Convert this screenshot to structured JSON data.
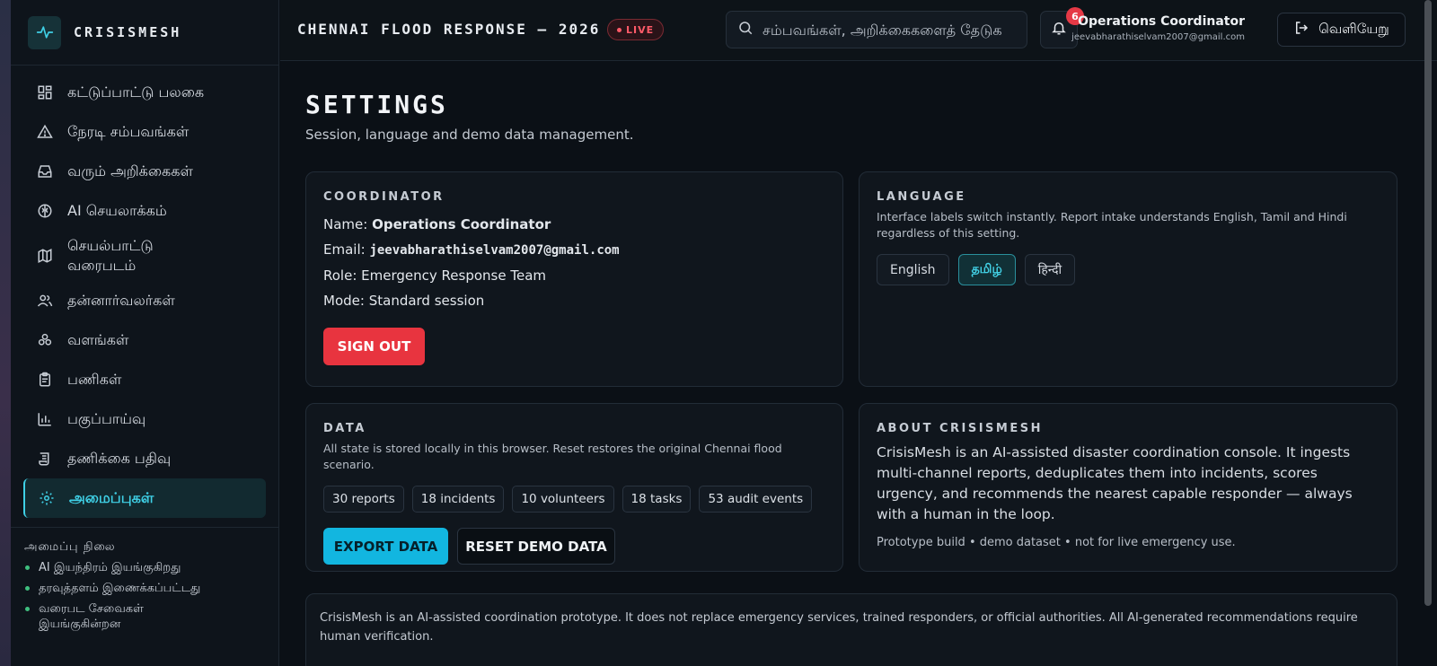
{
  "brand": {
    "name": "CRISISMESH"
  },
  "sidebar": {
    "items": [
      {
        "label": "கட்டுப்பாட்டு பலகை",
        "icon": "dashboard-icon"
      },
      {
        "label": "நேரடி சம்பவங்கள்",
        "icon": "warning-icon"
      },
      {
        "label": "வரும் அறிக்கைகள்",
        "icon": "inbox-icon"
      },
      {
        "label": "AI செயலாக்கம்",
        "icon": "brain-icon"
      },
      {
        "label": "செயல்பாட்டு வரைபடம்",
        "icon": "map-icon"
      },
      {
        "label": "தன்னார்வலர்கள்",
        "icon": "users-icon"
      },
      {
        "label": "வளங்கள்",
        "icon": "boxes-icon"
      },
      {
        "label": "பணிகள்",
        "icon": "clipboard-icon"
      },
      {
        "label": "பகுப்பாய்வு",
        "icon": "bar-chart-icon"
      },
      {
        "label": "தணிக்கை பதிவு",
        "icon": "scroll-icon"
      },
      {
        "label": "அமைப்புகள்",
        "icon": "gear-icon"
      }
    ],
    "system_title": "அமைப்பு நிலை",
    "system_items": [
      "AI இயந்திரம் இயங்குகிறது",
      "தரவுத்தளம் இணைக்கப்பட்டது",
      "வரைபட சேவைகள் இயங்குகின்றன"
    ]
  },
  "topbar": {
    "event_title": "CHENNAI FLOOD RESPONSE — 2026",
    "live_label": "LIVE",
    "search_placeholder": "சம்பவங்கள், அறிக்கைகளைத் தேடுக",
    "notification_count": "6",
    "user_name": "Operations Coordinator",
    "user_email": "jeevabharathiselvam2007@gmail.com",
    "logout_label": "வெளியேறு"
  },
  "page": {
    "title": "SETTINGS",
    "subtitle": "Session, language and demo data management."
  },
  "coordinator": {
    "heading": "COORDINATOR",
    "name_label": "Name:",
    "name_value": "Operations Coordinator",
    "email_label": "Email:",
    "email_value": "jeevabharathiselvam2007@gmail.com",
    "role_label": "Role:",
    "role_value": "Emergency Response Team",
    "mode_label": "Mode:",
    "mode_value": "Standard session",
    "signout_label": "SIGN OUT"
  },
  "language": {
    "heading": "LANGUAGE",
    "description": "Interface labels switch instantly. Report intake understands English, Tamil and Hindi regardless of this setting.",
    "options": [
      "English",
      "தமிழ்",
      "हिन्दी"
    ],
    "selected": "தமிழ்"
  },
  "data": {
    "heading": "DATA",
    "description": "All state is stored locally in this browser. Reset restores the original Chennai flood scenario.",
    "chips": [
      "30 reports",
      "18 incidents",
      "10 volunteers",
      "18 tasks",
      "53 audit events"
    ],
    "export_label": "EXPORT DATA",
    "reset_label": "RESET DEMO DATA"
  },
  "about": {
    "heading": "ABOUT CRISISMESH",
    "text": "CrisisMesh is an AI-assisted disaster coordination console. It ingests multi-channel reports, deduplicates them into incidents, scores urgency, and recommends the nearest capable responder — always with a human in the loop.",
    "footnote": "Prototype build • demo dataset • not for live emergency use."
  },
  "disclaimer": "CrisisMesh is an AI-assisted coordination prototype. It does not replace emergency services, trained responders, or official authorities. All AI-generated recommendations require human verification.",
  "colors": {
    "accent": "#3fd0e6",
    "danger": "#e8343f",
    "export": "#12b6e0",
    "status_ok": "#3fbf7f"
  }
}
